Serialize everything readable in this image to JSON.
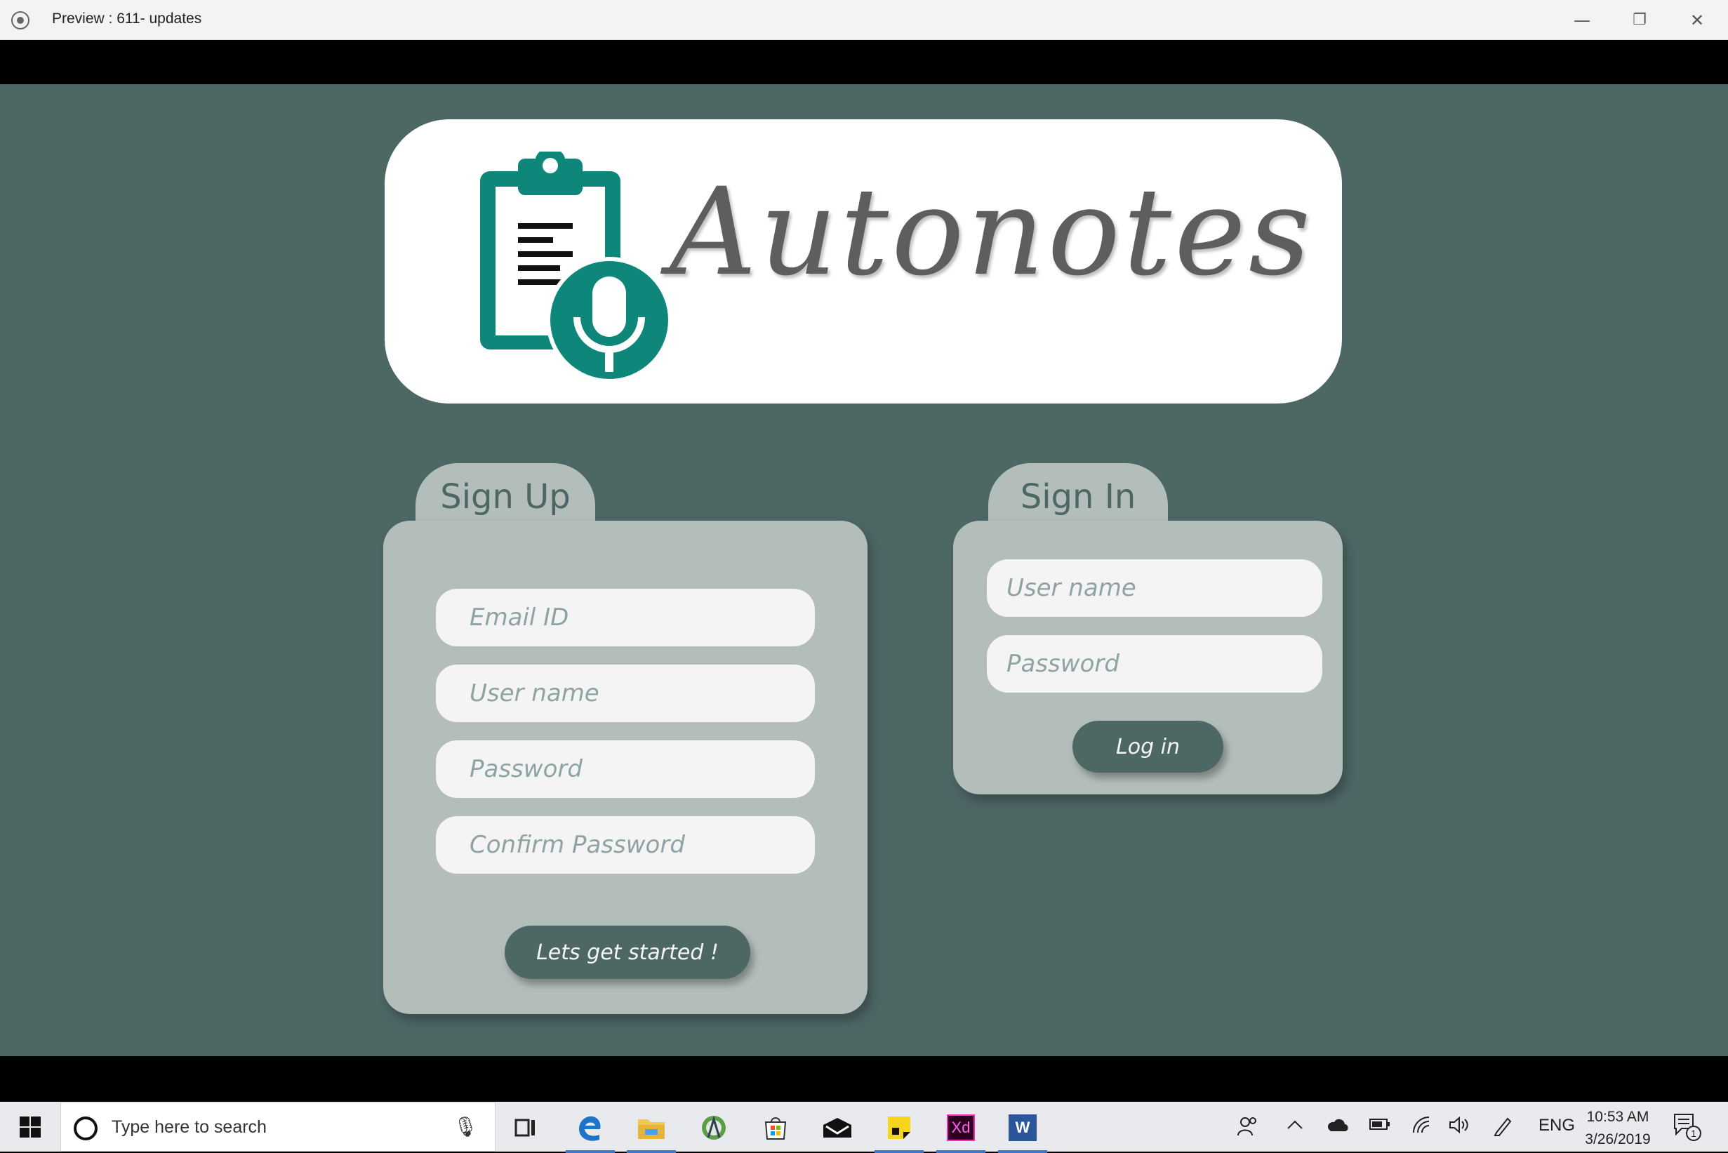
{
  "window": {
    "title": "Preview : 611- updates",
    "minimize_glyph": "—",
    "restore_glyph": "❐",
    "close_glyph": "✕"
  },
  "app": {
    "logo_text": "Autonotes",
    "colors": {
      "background": "#4d6765",
      "panel": "#b3bdba",
      "field": "#f4f4f4",
      "logo_teal": "#0e877a",
      "button": "#4d6765"
    }
  },
  "signup": {
    "tab_label": "Sign Up",
    "email_placeholder": "Email ID",
    "username_placeholder": "User name",
    "password_placeholder": "Password",
    "confirm_placeholder": "Confirm Password",
    "button_label": "Lets get started !"
  },
  "signin": {
    "tab_label": "Sign In",
    "username_placeholder": "User name",
    "password_placeholder": "Password",
    "button_label": "Log in"
  },
  "taskbar": {
    "search_placeholder": "Type here to search",
    "language": "ENG",
    "time": "10:53 AM",
    "date": "3/26/2019",
    "notification_count": "1",
    "xd_label": "Xd",
    "word_label": "W"
  }
}
